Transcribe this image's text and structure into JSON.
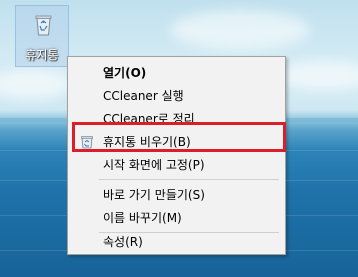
{
  "desktop": {
    "icon": {
      "name": "recycle-bin-icon",
      "label": "휴지통"
    }
  },
  "context_menu": {
    "items": [
      {
        "label": "열기(O)",
        "bold": true
      },
      {
        "label": "CCleaner 실행"
      },
      {
        "label": "CCleaner로 정리"
      },
      {
        "label": "휴지통 비우기(B)",
        "icon": "recycle-bin-small-icon",
        "highlighted": true
      },
      {
        "label": "시작 화면에 고정(P)"
      },
      {
        "label": "바로 가기 만들기(S)"
      },
      {
        "label": "이름 바꾸기(M)"
      },
      {
        "label": "속성(R)"
      }
    ]
  },
  "colors": {
    "highlight_border": "#d9202a",
    "menu_background": "#f2f2f2"
  }
}
